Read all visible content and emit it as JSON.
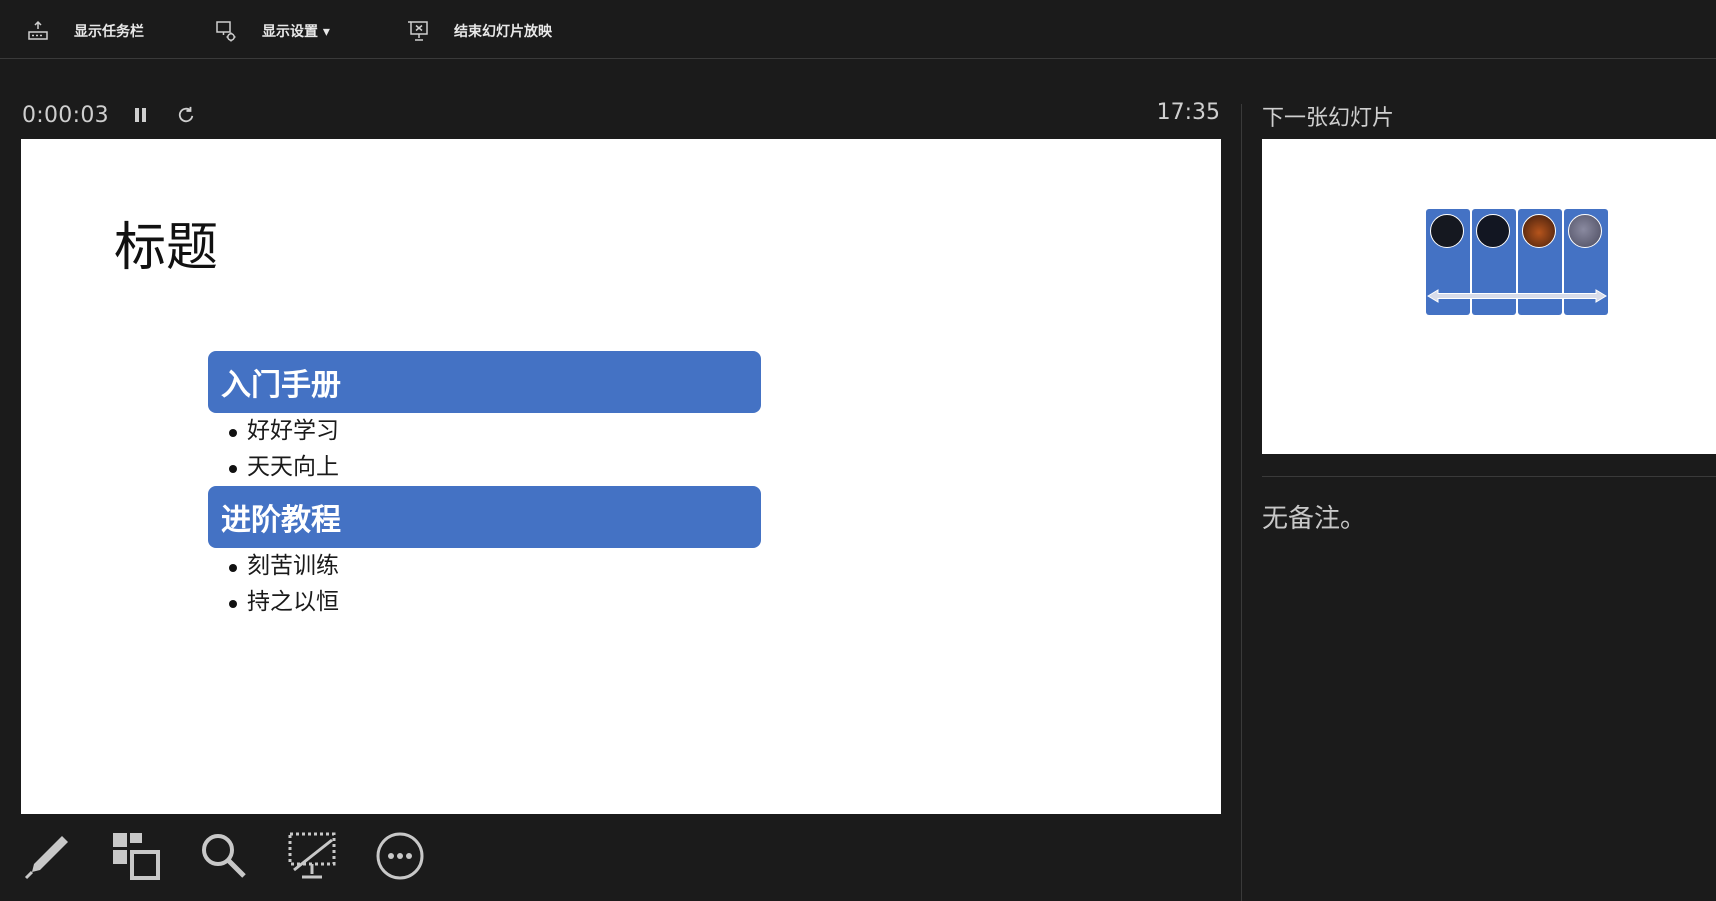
{
  "topbar": {
    "show_taskbar": "显示任务栏",
    "display_settings": "显示设置 ▾",
    "end_show": "结束幻灯片放映"
  },
  "timer": {
    "elapsed": "0:00:03",
    "clock": "17:35"
  },
  "slide": {
    "title": "标题",
    "sections": [
      {
        "heading": "入门手册",
        "items": [
          "好好学习",
          "天天向上"
        ]
      },
      {
        "heading": "进阶教程",
        "items": [
          "刻苦训练",
          "持之以恒"
        ]
      }
    ],
    "accent_color": "#4472c4"
  },
  "next_slide": {
    "label": "下一张幻灯片"
  },
  "notes": {
    "text": "无备注。"
  },
  "icons": [
    "taskbar-icon",
    "display-settings-icon",
    "end-show-icon",
    "pause-icon",
    "restart-icon",
    "pen-icon",
    "all-slides-icon",
    "zoom-icon",
    "black-screen-icon",
    "more-options-icon"
  ]
}
